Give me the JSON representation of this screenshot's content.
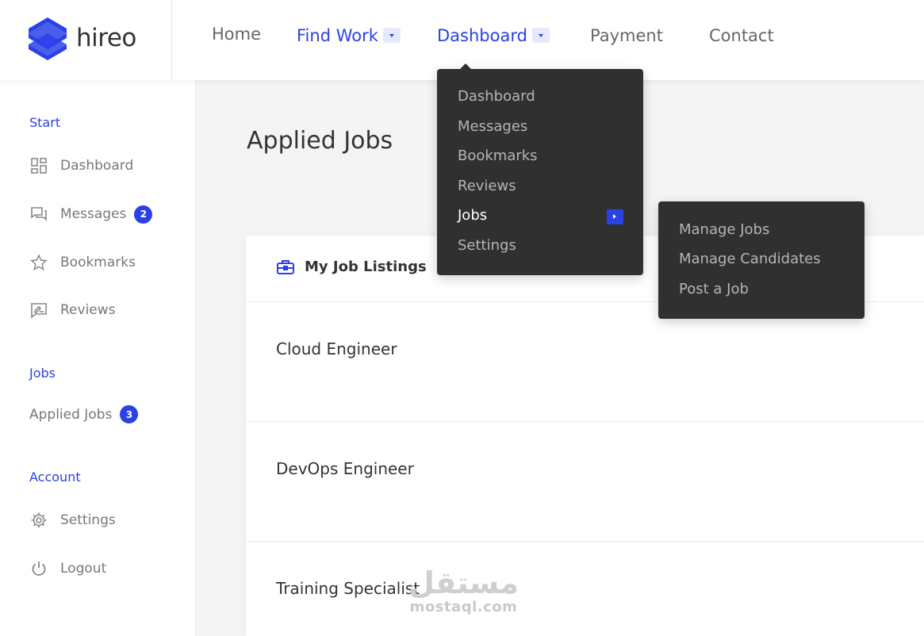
{
  "brand": {
    "name": "hireo",
    "color": "#2a41e8"
  },
  "nav": {
    "items": [
      {
        "label": "Home",
        "has_caret": false,
        "active": false
      },
      {
        "label": "Find Work",
        "has_caret": true,
        "active": true
      },
      {
        "label": "Dashboard",
        "has_caret": true,
        "active": true
      },
      {
        "label": "Payment",
        "has_caret": false,
        "active": false
      },
      {
        "label": "Contact",
        "has_caret": false,
        "active": false
      }
    ]
  },
  "dashboard_menu": {
    "items": [
      {
        "label": "Dashboard"
      },
      {
        "label": "Messages"
      },
      {
        "label": "Bookmarks"
      },
      {
        "label": "Reviews"
      },
      {
        "label": "Jobs",
        "active": true,
        "has_submenu": true
      },
      {
        "label": "Settings"
      }
    ]
  },
  "jobs_submenu": {
    "items": [
      {
        "label": "Manage Jobs"
      },
      {
        "label": "Manage Candidates"
      },
      {
        "label": "Post a Job"
      }
    ]
  },
  "sidebar": {
    "sections": [
      {
        "heading": "Start"
      },
      {
        "heading": "Jobs"
      },
      {
        "heading": "Account"
      }
    ],
    "items": [
      {
        "label": "Dashboard",
        "icon": "dashboard-icon"
      },
      {
        "label": "Messages",
        "icon": "messages-icon",
        "badge": "2"
      },
      {
        "label": "Bookmarks",
        "icon": "star-icon"
      },
      {
        "label": "Reviews",
        "icon": "reviews-icon"
      },
      {
        "label": "Applied Jobs",
        "badge": "3"
      },
      {
        "label": "Settings",
        "icon": "gear-icon"
      },
      {
        "label": "Logout",
        "icon": "power-icon"
      }
    ]
  },
  "main": {
    "page_title": "Applied Jobs",
    "card": {
      "title": "My Job Listings",
      "icon": "briefcase-icon",
      "jobs": [
        {
          "title": "Cloud Engineer"
        },
        {
          "title": "DevOps Engineer"
        },
        {
          "title": "Training Specialist"
        }
      ]
    }
  },
  "watermark": {
    "arabic": "مستقل",
    "latin": "mostaql.com"
  }
}
